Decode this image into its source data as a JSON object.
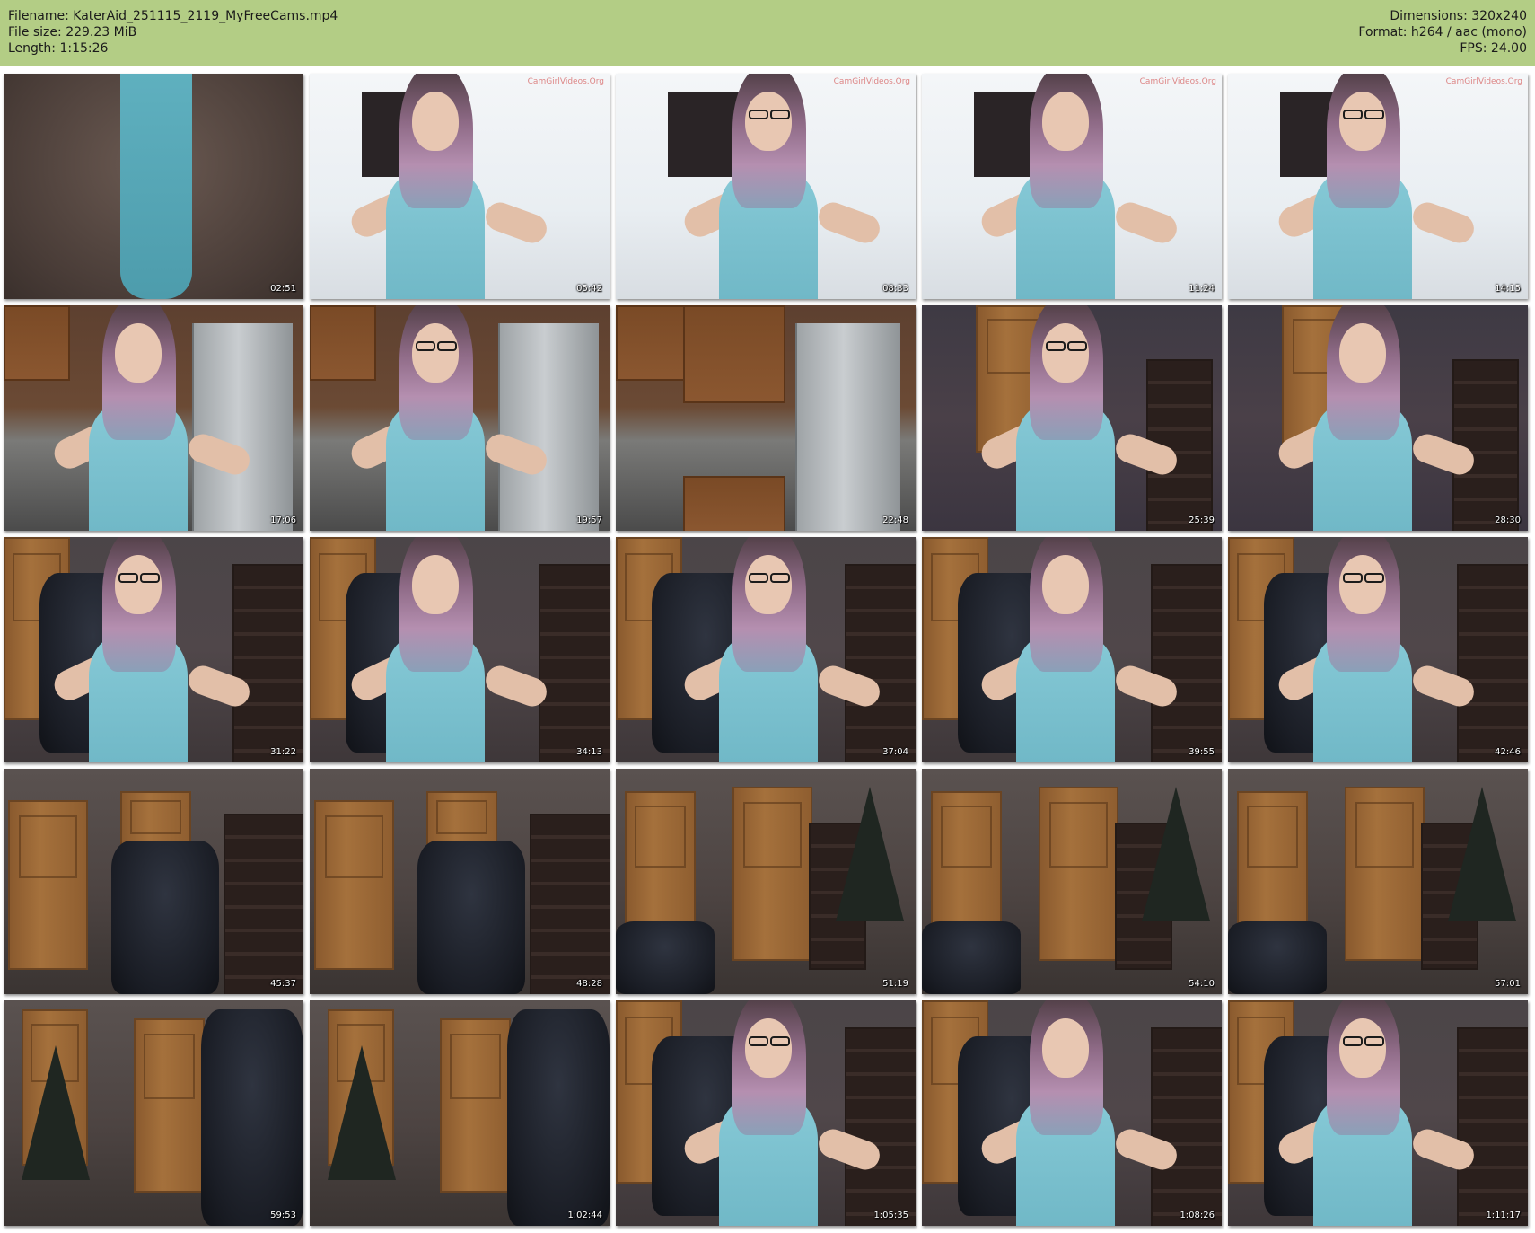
{
  "header": {
    "filename_line": "Filename: KaterAid_251115_2119_MyFreeCams.mp4",
    "filesize_line": "File size: 229.23 MiB",
    "length_line": "Length: 1:15:26",
    "dimensions_line": "Dimensions: 320x240",
    "format_line": "Format: h264 / aac (mono)",
    "fps_line": "FPS: 24.00",
    "background_color": "#b3cd85"
  },
  "thumbnails": [
    {
      "timestamp": "02:51",
      "scene": "closeup",
      "watermark": ""
    },
    {
      "timestamp": "05:42",
      "scene": "window",
      "watermark": "CamGirlVideos.Org"
    },
    {
      "timestamp": "08:33",
      "scene": "window",
      "watermark": "CamGirlVideos.Org"
    },
    {
      "timestamp": "11:24",
      "scene": "window",
      "watermark": "CamGirlVideos.Org"
    },
    {
      "timestamp": "14:15",
      "scene": "window",
      "watermark": "CamGirlVideos.Org"
    },
    {
      "timestamp": "17:06",
      "scene": "kitchen",
      "watermark": ""
    },
    {
      "timestamp": "19:57",
      "scene": "kitchen",
      "watermark": ""
    },
    {
      "timestamp": "22:48",
      "scene": "kitchen-empty",
      "watermark": ""
    },
    {
      "timestamp": "25:39",
      "scene": "bedroom",
      "watermark": ""
    },
    {
      "timestamp": "28:30",
      "scene": "bedroom",
      "watermark": ""
    },
    {
      "timestamp": "31:22",
      "scene": "office",
      "watermark": ""
    },
    {
      "timestamp": "34:13",
      "scene": "office",
      "watermark": ""
    },
    {
      "timestamp": "37:04",
      "scene": "office",
      "watermark": ""
    },
    {
      "timestamp": "39:55",
      "scene": "office",
      "watermark": ""
    },
    {
      "timestamp": "42:46",
      "scene": "office",
      "watermark": ""
    },
    {
      "timestamp": "45:37",
      "scene": "room-chair",
      "watermark": ""
    },
    {
      "timestamp": "48:28",
      "scene": "room-chair",
      "watermark": ""
    },
    {
      "timestamp": "51:19",
      "scene": "room-door",
      "watermark": ""
    },
    {
      "timestamp": "54:10",
      "scene": "room-door",
      "watermark": ""
    },
    {
      "timestamp": "57:01",
      "scene": "room-door",
      "watermark": ""
    },
    {
      "timestamp": "59:53",
      "scene": "room-tree",
      "watermark": ""
    },
    {
      "timestamp": "1:02:44",
      "scene": "room-tree",
      "watermark": ""
    },
    {
      "timestamp": "1:05:35",
      "scene": "office",
      "watermark": ""
    },
    {
      "timestamp": "1:08:26",
      "scene": "office",
      "watermark": ""
    },
    {
      "timestamp": "1:11:17",
      "scene": "office",
      "watermark": ""
    }
  ]
}
